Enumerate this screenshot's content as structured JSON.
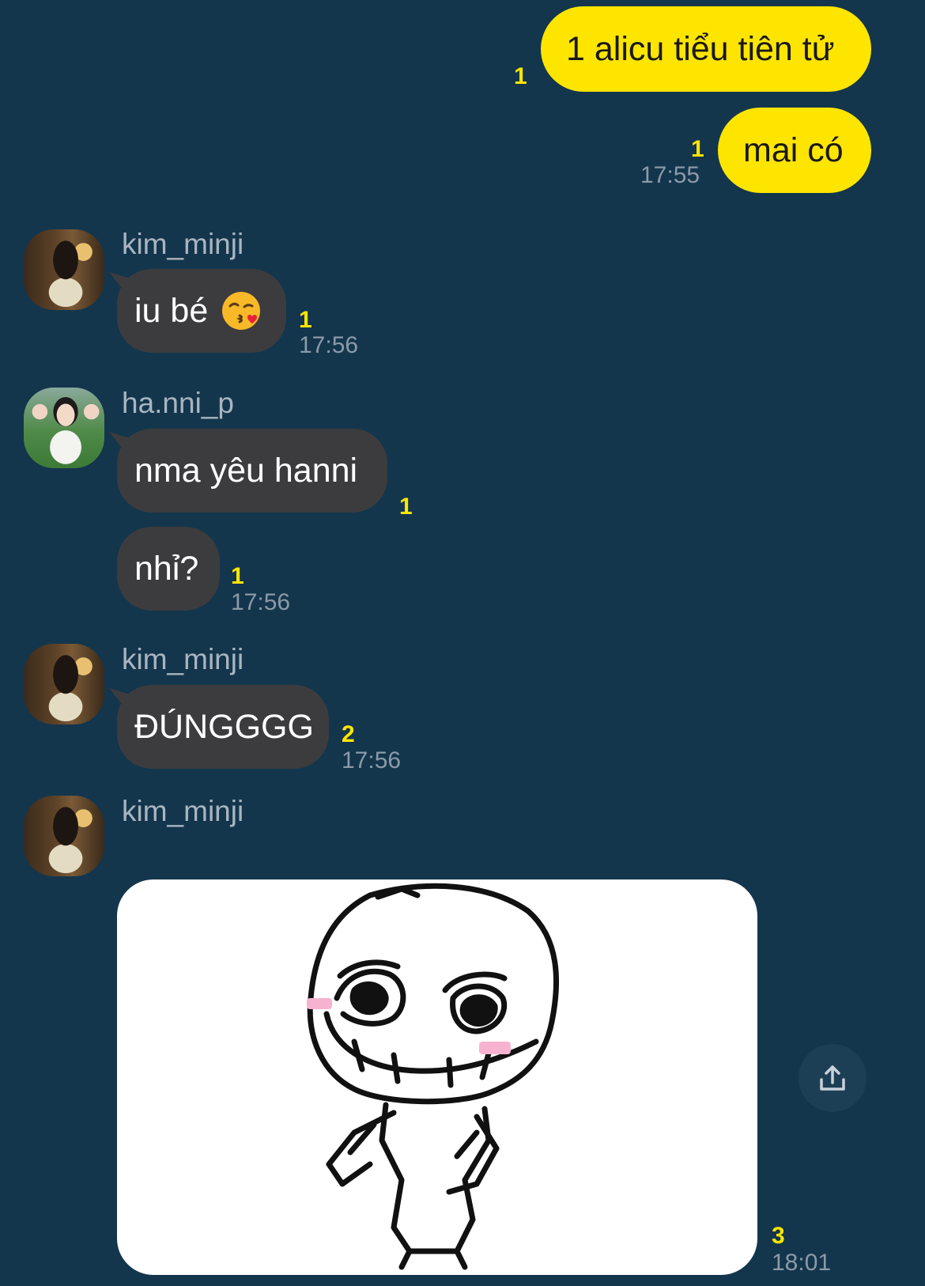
{
  "messages": [
    {
      "text": "1 alicu tiểu tiên tử",
      "unread": "1"
    },
    {
      "text": "mai có",
      "unread": "1",
      "time": "17:55"
    },
    {
      "sender": "kim_minji",
      "text": "iu bé",
      "emoji": "kissing-face-heart-icon",
      "unread": "1",
      "time": "17:56"
    },
    {
      "sender": "ha.nni_p",
      "text": "nma yêu hanni",
      "unread": "1"
    },
    {
      "text": "nhỉ?",
      "unread": "1",
      "time": "17:56"
    },
    {
      "sender": "kim_minji",
      "text": "ĐÚNGGGG",
      "unread": "2",
      "time": "17:56"
    },
    {
      "sender": "kim_minji",
      "type": "sticker",
      "sticker": "smug-meme-face-sticker",
      "unread": "3",
      "time": "18:01"
    }
  ],
  "colors": {
    "background": "#13364d",
    "my_bubble": "#fee500",
    "their_bubble": "#3c3c3e",
    "unread": "#fee500",
    "time": "#8b9aa8"
  },
  "icons": {
    "share": "share-icon"
  }
}
